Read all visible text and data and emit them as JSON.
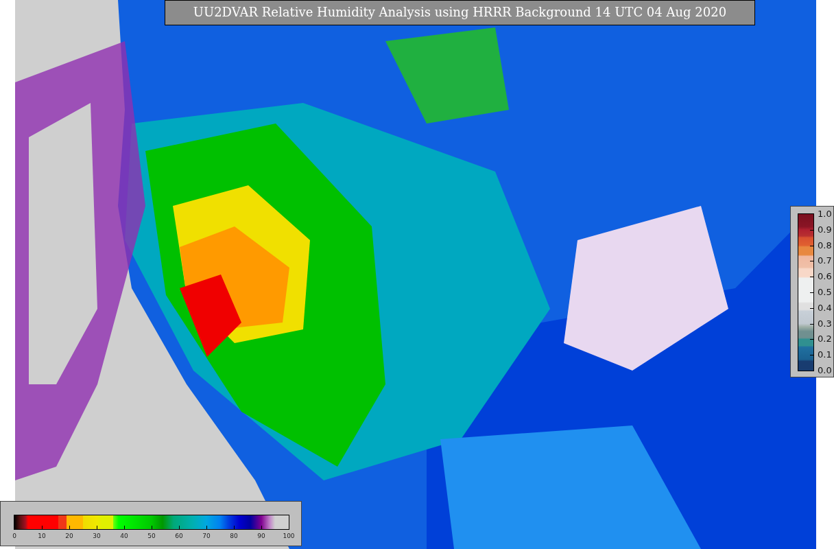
{
  "title": "UU2DVAR Relative Humidity Analysis using HRRR Background 14 UTC 04 Aug 2020",
  "right_colorbar": {
    "ticks": [
      "1.0",
      "0.9",
      "0.8",
      "0.7",
      "0.6",
      "0.5",
      "0.4",
      "0.3",
      "0.2",
      "0.1",
      "0.0"
    ]
  },
  "bottom_colorbar": {
    "ticks": [
      "0",
      "10",
      "20",
      "30",
      "40",
      "50",
      "60",
      "70",
      "80",
      "90",
      "100"
    ]
  }
}
